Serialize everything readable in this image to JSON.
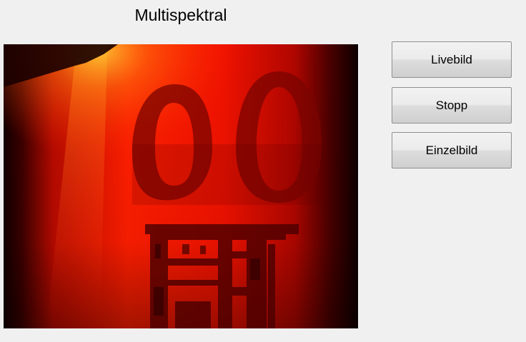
{
  "window": {
    "title": "Multispektral"
  },
  "camera_view": {
    "tint": "#ff1a00",
    "content": "camera-live-image"
  },
  "buttons": {
    "live_label": "Livebild",
    "stop_label": "Stopp",
    "single_label": "Einzelbild"
  }
}
